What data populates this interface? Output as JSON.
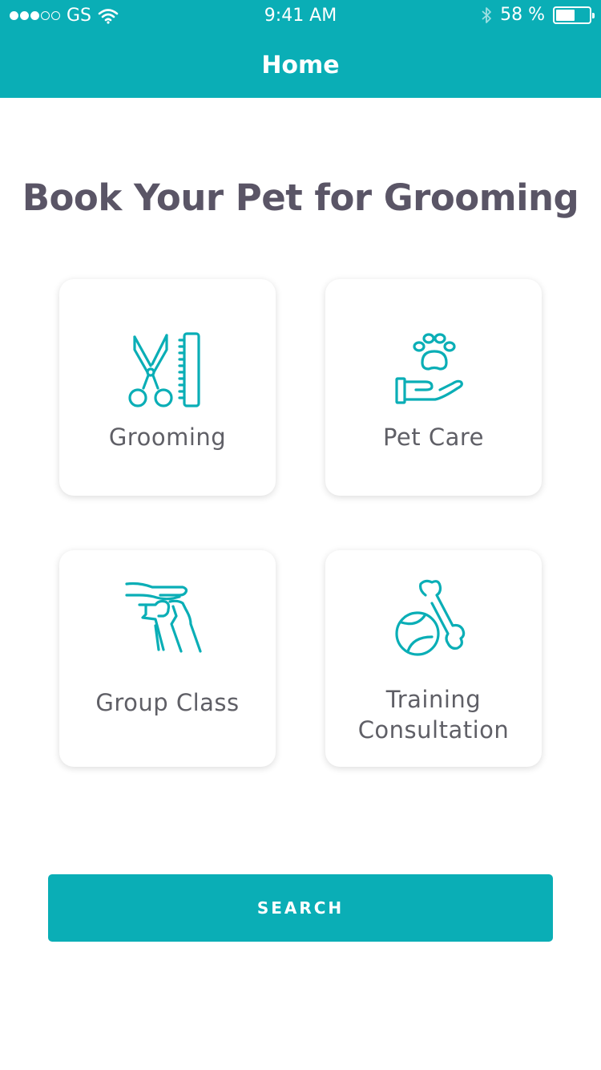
{
  "status_bar": {
    "carrier": "GS",
    "time": "9:41 AM",
    "battery_percent": "58 %",
    "battery_level": 0.58,
    "signal_bars_filled": 3,
    "signal_bars_total": 5
  },
  "nav": {
    "title": "Home"
  },
  "main": {
    "heading": "Book Your Pet for Grooming",
    "cards": [
      {
        "label": "Grooming",
        "icon": "scissors-comb-icon"
      },
      {
        "label": "Pet Care",
        "icon": "paw-hand-icon"
      },
      {
        "label": "Group Class",
        "icon": "hand-petting-dog-icon"
      },
      {
        "label_line1": "Training",
        "label_line2": "Consultation",
        "icon": "bone-ball-icon"
      }
    ]
  },
  "search_button": {
    "label": "SEARCH"
  },
  "colors": {
    "accent": "#0aaeb6",
    "heading": "#5a5566",
    "label": "#5f5f66"
  }
}
